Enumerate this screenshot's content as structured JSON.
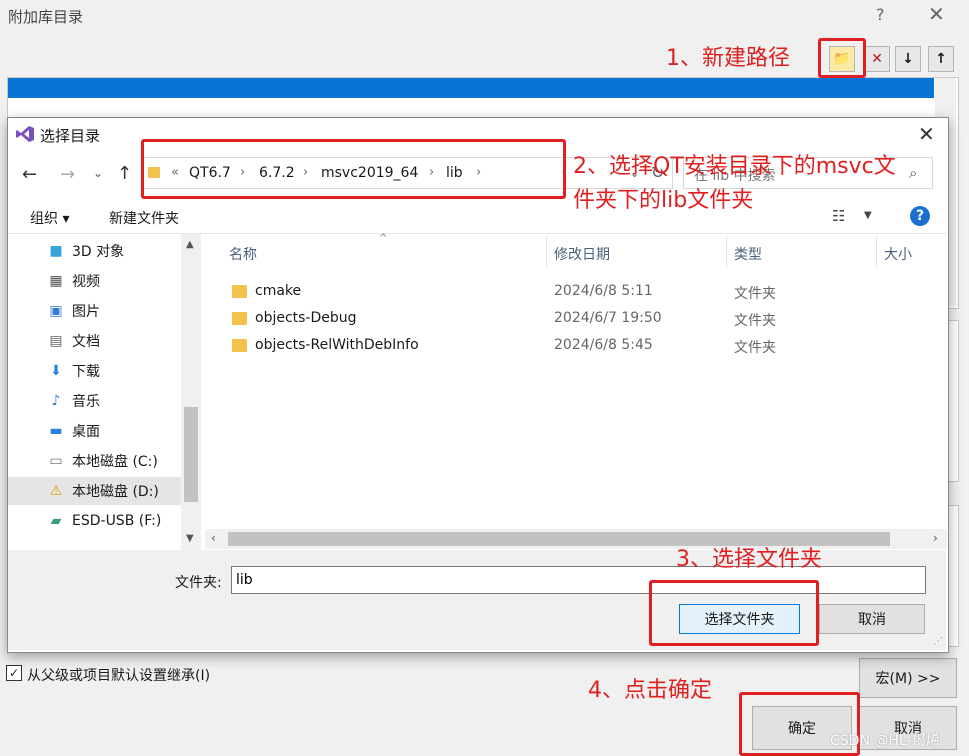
{
  "outer": {
    "title": "附加库目录",
    "help": "?",
    "close": "✕",
    "toolbar": {
      "new": "📁",
      "delete": "✕",
      "down": "↓",
      "up": "↑"
    },
    "inherit_label": "从父级或项目默认设置继承(I)",
    "macro_button": "宏(M) >>",
    "ok_button": "确定",
    "cancel_button": "取消"
  },
  "inner": {
    "title": "选择目录",
    "breadcrumbs": [
      "QT6.7",
      "6.7.2",
      "msvc2019_64",
      "lib"
    ],
    "crumb_prefix": "«",
    "search_placeholder": "在 lib 中搜索",
    "organize": "组织 ▾",
    "new_folder": "新建文件夹",
    "help": "?",
    "nav_items": [
      {
        "label": "3D 对象",
        "icon": "cube-icon"
      },
      {
        "label": "视频",
        "icon": "video-icon"
      },
      {
        "label": "图片",
        "icon": "picture-icon"
      },
      {
        "label": "文档",
        "icon": "document-icon"
      },
      {
        "label": "下载",
        "icon": "download-icon"
      },
      {
        "label": "音乐",
        "icon": "music-icon"
      },
      {
        "label": "桌面",
        "icon": "desktop-icon"
      },
      {
        "label": "本地磁盘 (C:)",
        "icon": "drive-icon"
      },
      {
        "label": "本地磁盘 (D:)",
        "icon": "drive-warning-icon"
      },
      {
        "label": "ESD-USB (F:)",
        "icon": "usb-drive-icon"
      }
    ],
    "columns": {
      "name": "名称",
      "date": "修改日期",
      "type": "类型",
      "size": "大小"
    },
    "files": [
      {
        "name": "cmake",
        "date": "2024/6/8 5:11",
        "type": "文件夹"
      },
      {
        "name": "objects-Debug",
        "date": "2024/6/7 19:50",
        "type": "文件夹"
      },
      {
        "name": "objects-RelWithDebInfo",
        "date": "2024/6/8 5:45",
        "type": "文件夹"
      }
    ],
    "folder_label": "文件夹:",
    "folder_value": "lib",
    "select_button": "选择文件夹",
    "cancel_button": "取消"
  },
  "annotations": {
    "step1": "1、新建路径",
    "step2_line1": "2、选择QT安装目录下的msvc文",
    "step2_line2": "件夹下的lib文件夹",
    "step3": "3、选择文件夹",
    "step4": "4、点击确定"
  },
  "watermark": "CSDN @HL-羯烯",
  "colors": {
    "accent": "#0a74d4",
    "annotation": "#e02020",
    "folder": "#f3c24c"
  }
}
